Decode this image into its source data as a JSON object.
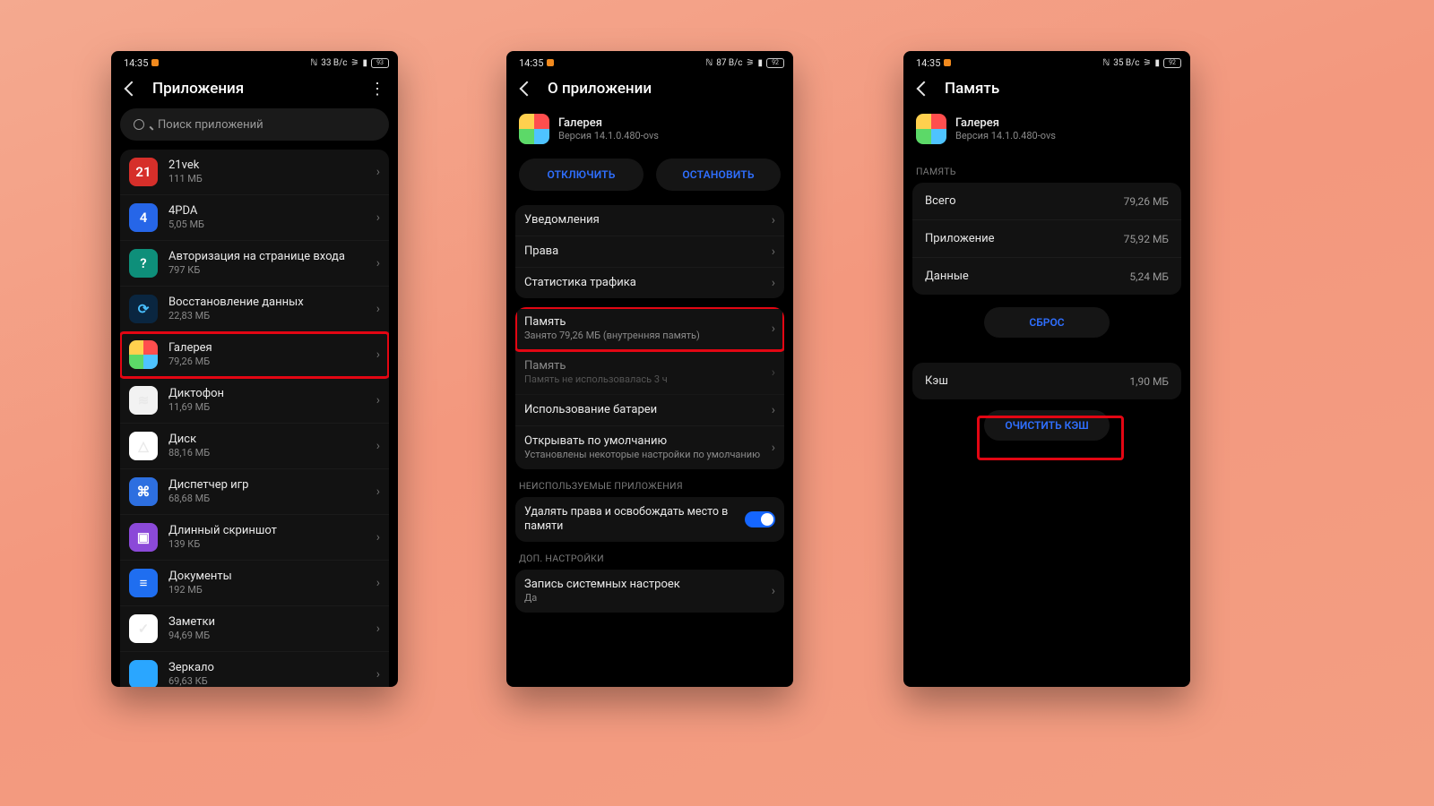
{
  "status": {
    "time": "14:35",
    "net": "33 В/с",
    "net2": "87 В/с",
    "net3": "35 В/с",
    "batt1": "93",
    "batt2": "92",
    "batt3": "92"
  },
  "screen1": {
    "title": "Приложения",
    "search_placeholder": "Поиск приложений",
    "apps": [
      {
        "name": "21vek",
        "sub": "111 МБ"
      },
      {
        "name": "4PDA",
        "sub": "5,05 МБ"
      },
      {
        "name": "Авторизация на странице входа",
        "sub": "797 КБ"
      },
      {
        "name": "Восстановление данных",
        "sub": "22,83 МБ"
      },
      {
        "name": "Галерея",
        "sub": "79,26 МБ"
      },
      {
        "name": "Диктофон",
        "sub": "11,69 МБ"
      },
      {
        "name": "Диск",
        "sub": "88,16 МБ"
      },
      {
        "name": "Диспетчер игр",
        "sub": "68,68 МБ"
      },
      {
        "name": "Длинный скриншот",
        "sub": "139 КБ"
      },
      {
        "name": "Документы",
        "sub": "192 МБ"
      },
      {
        "name": "Заметки",
        "sub": "94,69 МБ"
      },
      {
        "name": "Зеркало",
        "sub": "69,63 КБ"
      }
    ]
  },
  "screen2": {
    "title": "О приложении",
    "app_name": "Галерея",
    "app_version": "Версия 14.1.0.480-ovs",
    "btn_disable": "ОТКЛЮЧИТЬ",
    "btn_stop": "ОСТАНОВИТЬ",
    "rows": {
      "notifications": "Уведомления",
      "permissions": "Права",
      "traffic": "Статистика трафика",
      "storage": "Память",
      "storage_sub": "Занято 79,26 МБ (внутренняя память)",
      "memory": "Память",
      "memory_sub": "Память не использовалась 3 ч",
      "battery": "Использование батареи",
      "open_default": "Открывать по умолчанию",
      "open_default_sub": "Установлены некоторые настройки по умолчанию"
    },
    "section_unused": "НЕИСПОЛЬЗУЕМЫЕ ПРИЛОЖЕНИЯ",
    "unused_toggle": "Удалять права и освобождать место в памяти",
    "section_extra": "ДОП. НАСТРОЙКИ",
    "sys_write": "Запись системных настроек",
    "sys_write_sub": "Да"
  },
  "screen3": {
    "title": "Память",
    "app_name": "Галерея",
    "app_version": "Версия 14.1.0.480-ovs",
    "section": "ПАМЯТЬ",
    "total_k": "Всего",
    "total_v": "79,26 МБ",
    "app_k": "Приложение",
    "app_v": "75,92 МБ",
    "data_k": "Данные",
    "data_v": "5,24 МБ",
    "btn_reset": "СБРОС",
    "cache_k": "Кэш",
    "cache_v": "1,90 МБ",
    "btn_clear": "ОЧИСТИТЬ КЭШ"
  }
}
